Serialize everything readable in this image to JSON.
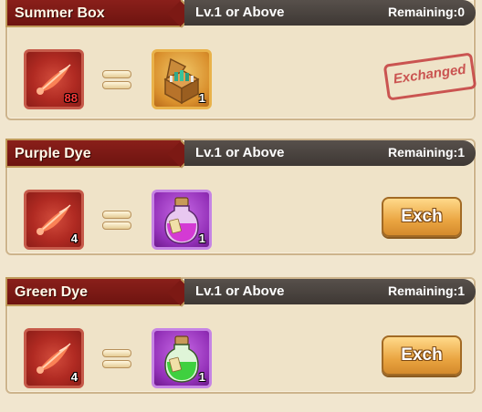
{
  "exchanges": [
    {
      "title": "Summer Box",
      "level": "Lv.1 or Above",
      "remaining": "Remaining:0",
      "cost": {
        "icon": "red-fish-icon",
        "qty": "88"
      },
      "reward": {
        "icon": "treasure-chest-icon",
        "qty": "1"
      },
      "status": "Exchanged"
    },
    {
      "title": "Purple Dye",
      "level": "Lv.1 or Above",
      "remaining": "Remaining:1",
      "cost": {
        "icon": "red-fish-icon",
        "qty": "4"
      },
      "reward": {
        "icon": "purple-potion-icon",
        "qty": "1"
      },
      "button": "Exch"
    },
    {
      "title": "Green Dye",
      "level": "Lv.1 or Above",
      "remaining": "Remaining:1",
      "cost": {
        "icon": "red-fish-icon",
        "qty": "4"
      },
      "reward": {
        "icon": "green-potion-icon",
        "qty": "1"
      },
      "button": "Exch"
    }
  ],
  "colors": {
    "banner_red": "#7c1914",
    "info_bar": "#4a4440",
    "card_bg": "#efe3c8",
    "button_gold": "#eaa541",
    "stamp_red": "#c54141"
  }
}
